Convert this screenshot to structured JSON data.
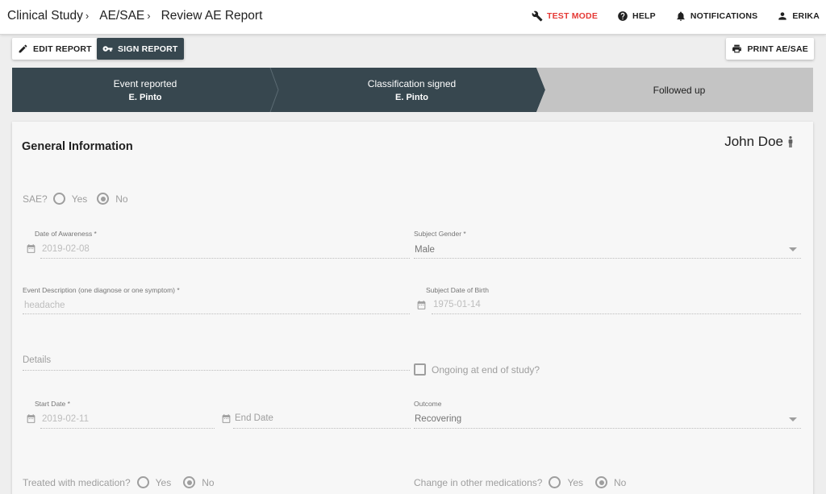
{
  "breadcrumb": {
    "items": [
      "Clinical Study",
      "AE/SAE",
      "Review AE Report"
    ],
    "separator": "›"
  },
  "topnav": {
    "test_mode": "TEST MODE",
    "help": "HELP",
    "notifications": "NOTIFICATIONS",
    "user": "ERIKA"
  },
  "toolbar": {
    "edit": "EDIT REPORT",
    "sign": "SIGN REPORT",
    "print": "PRINT AE/SAE"
  },
  "stepper": {
    "steps": [
      {
        "title": "Event reported",
        "who": "E. Pinto"
      },
      {
        "title": "Classification signed",
        "who": "E. Pinto"
      },
      {
        "title": "Followed up",
        "who": ""
      }
    ]
  },
  "card": {
    "title": "General Information",
    "patient": "John Doe"
  },
  "form": {
    "sae": {
      "label": "SAE?",
      "yes": "Yes",
      "no": "No",
      "selected": "No"
    },
    "date_awareness": {
      "label": "Date of Awareness *",
      "value": "2019-02-08"
    },
    "subject_gender": {
      "label": "Subject Gender *",
      "value": "Male"
    },
    "event_description": {
      "label": "Event Description (one diagnose or one symptom) *",
      "value": "headache"
    },
    "subject_dob": {
      "label": "Subject Date of Birth",
      "value": "1975-01-14"
    },
    "details": {
      "placeholder": "Details"
    },
    "ongoing": {
      "label": "Ongoing at end of study?"
    },
    "start_date": {
      "label": "Start Date *",
      "value": "2019-02-11"
    },
    "end_date": {
      "placeholder": "End Date"
    },
    "outcome": {
      "label": "Outcome",
      "value": "Recovering"
    },
    "treated": {
      "label": "Treated with medication?",
      "yes": "Yes",
      "no": "No",
      "selected": "No"
    },
    "change_meds": {
      "label": "Change in other medications?",
      "yes": "Yes",
      "no": "No",
      "selected": "No"
    }
  },
  "colors": {
    "accent_dark": "#37474f",
    "test_mode": "#e53935",
    "step_inactive": "#c4c4c4"
  }
}
